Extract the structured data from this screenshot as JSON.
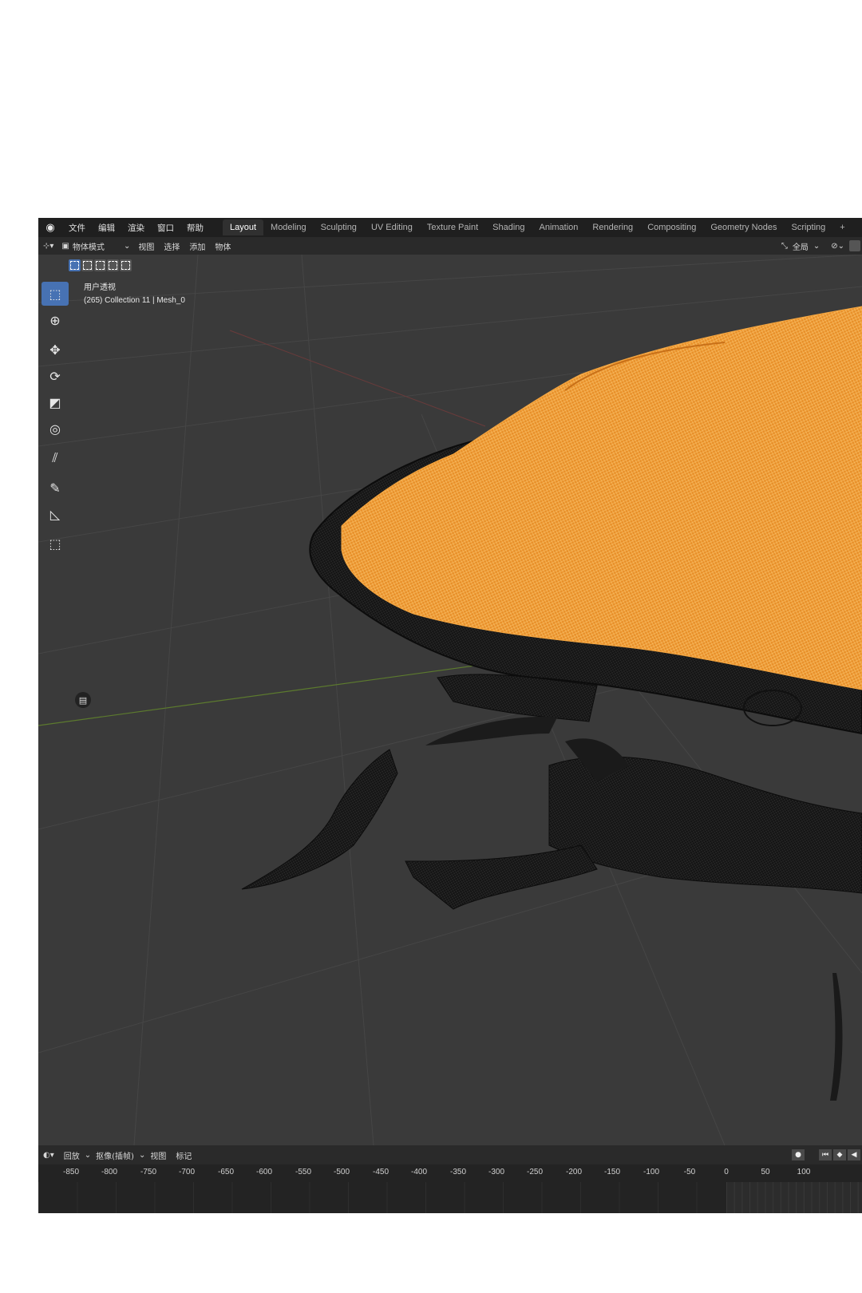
{
  "topbar": {
    "logo": "blender-logo",
    "menus": [
      "文件",
      "编辑",
      "渲染",
      "窗口",
      "帮助"
    ],
    "workspaces": [
      {
        "label": "Layout",
        "active": true
      },
      {
        "label": "Modeling",
        "active": false
      },
      {
        "label": "Sculpting",
        "active": false
      },
      {
        "label": "UV Editing",
        "active": false
      },
      {
        "label": "Texture Paint",
        "active": false
      },
      {
        "label": "Shading",
        "active": false
      },
      {
        "label": "Animation",
        "active": false
      },
      {
        "label": "Rendering",
        "active": false
      },
      {
        "label": "Compositing",
        "active": false
      },
      {
        "label": "Geometry Nodes",
        "active": false
      },
      {
        "label": "Scripting",
        "active": false
      }
    ],
    "add_workspace": "+"
  },
  "header": {
    "mode": "物体模式",
    "menus": [
      "视图",
      "选择",
      "添加",
      "物体"
    ],
    "orientation": "全局"
  },
  "viewport": {
    "view_name": "用户透视",
    "object_info": "(265) Collection 11 | Mesh_0",
    "selected_color": "#f2a030",
    "wire_color": "#151515",
    "background": "#3a3a3a"
  },
  "timeline": {
    "menus": [
      "回放",
      "抠像(插帧)",
      "视图",
      "标记"
    ],
    "ruler": [
      "-850",
      "-800",
      "-750",
      "-700",
      "-650",
      "-600",
      "-550",
      "-500",
      "-450",
      "-400",
      "-350",
      "-300",
      "-250",
      "-200",
      "-150",
      "-100",
      "-50",
      "0",
      "50",
      "100"
    ]
  }
}
